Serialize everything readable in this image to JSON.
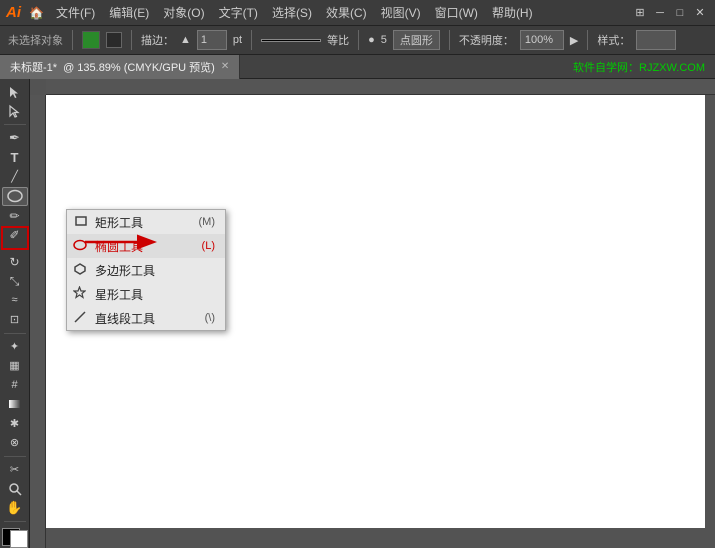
{
  "titleBar": {
    "logo": "Ai",
    "menus": [
      "文件(F)",
      "编辑(E)",
      "对象(O)",
      "文字(T)",
      "选择(S)",
      "效果(C)",
      "视图(V)",
      "窗口(W)",
      "帮助(H)"
    ],
    "gridIcon": "⊞"
  },
  "optionsBar": {
    "noSelection": "未选择对象",
    "stroke": "描边：",
    "strokeValue": "1",
    "strokeUnit": "pt",
    "ratioSymbol": "等比",
    "pointCount": "5",
    "pointShape": "点圆形",
    "opacity": "不透明度：",
    "opacityValue": "100%",
    "style": "样式："
  },
  "tabBar": {
    "tabName": "未标题-1*",
    "tabInfo": "@ 135.89% (CMYK/GPU 预览)",
    "website": "软件自学网：RJZXW.COM"
  },
  "toolbar": {
    "tools": [
      {
        "name": "selection",
        "icon": "▶"
      },
      {
        "name": "direct-selection",
        "icon": "↖"
      },
      {
        "name": "pen",
        "icon": "✒"
      },
      {
        "name": "type",
        "icon": "T"
      },
      {
        "name": "line",
        "icon": "\\"
      },
      {
        "name": "shape",
        "icon": "⬭"
      },
      {
        "name": "paintbrush",
        "icon": "✏"
      },
      {
        "name": "pencil",
        "icon": "✐"
      },
      {
        "name": "rotate",
        "icon": "↻"
      },
      {
        "name": "scale",
        "icon": "⤡"
      },
      {
        "name": "warp",
        "icon": "〰"
      },
      {
        "name": "free-transform",
        "icon": "⊡"
      },
      {
        "name": "symbol",
        "icon": "❋"
      },
      {
        "name": "column-graph",
        "icon": "▦"
      },
      {
        "name": "mesh",
        "icon": "#"
      },
      {
        "name": "gradient",
        "icon": "◫"
      },
      {
        "name": "eyedropper",
        "icon": "✱"
      },
      {
        "name": "blend",
        "icon": "⊗"
      },
      {
        "name": "slice",
        "icon": "✂"
      },
      {
        "name": "zoom",
        "icon": "🔍"
      },
      {
        "name": "hand",
        "icon": "✋"
      }
    ]
  },
  "contextMenu": {
    "items": [
      {
        "label": "矩形工具",
        "shortcut": "(M)",
        "icon": "rect"
      },
      {
        "label": "椭圆工具",
        "shortcut": "(L)",
        "icon": "circle",
        "highlighted": true
      },
      {
        "label": "多边形工具",
        "shortcut": "",
        "icon": "poly"
      },
      {
        "label": "星形工具",
        "shortcut": "",
        "icon": "star"
      },
      {
        "label": "直线段工具",
        "shortcut": "(\\)",
        "icon": "line"
      }
    ]
  }
}
